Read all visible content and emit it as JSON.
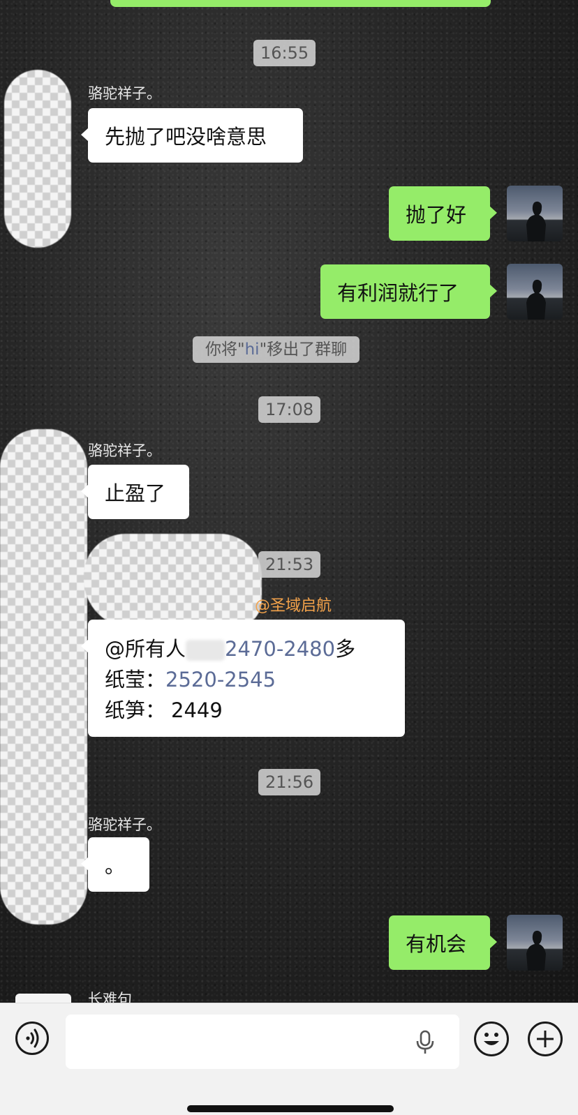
{
  "chat": {
    "times": [
      "16:55",
      "17:08",
      "21:53",
      "21:56"
    ],
    "system_notice": {
      "before": "你将\"",
      "name": "hi",
      "after": "\"移出了群聊"
    },
    "sender_name": "骆驼祥子。",
    "next_sender_partial": "长难句",
    "mention_tag": "@圣域启航",
    "messages": [
      {
        "dir": "in",
        "text": "先抛了吧没啥意思"
      },
      {
        "dir": "out",
        "text": "抛了好"
      },
      {
        "dir": "out",
        "text": "有利润就行了"
      },
      {
        "dir": "in",
        "text": "止盈了"
      },
      {
        "dir": "in",
        "text": "。"
      },
      {
        "dir": "out",
        "text": "有机会"
      }
    ],
    "announcement": {
      "line1_prefix": "@所有人",
      "line1_num": "2470-2480",
      "line1_suffix": "多",
      "line2_label": "纸莹：",
      "line2_num": "2520-2545",
      "line3_label": "纸笋：",
      "line3_num": "2449"
    }
  },
  "input_bar": {
    "voice_icon": "voice-wave-icon",
    "mic_icon": "microphone-icon",
    "emoji_icon": "smiley-icon",
    "plus_icon": "plus-circle-icon"
  },
  "colors": {
    "outgoing_bubble": "#95ec69",
    "incoming_bubble": "#ffffff",
    "mention": "#f3a24a",
    "highlight_number": "#5b6b96"
  }
}
